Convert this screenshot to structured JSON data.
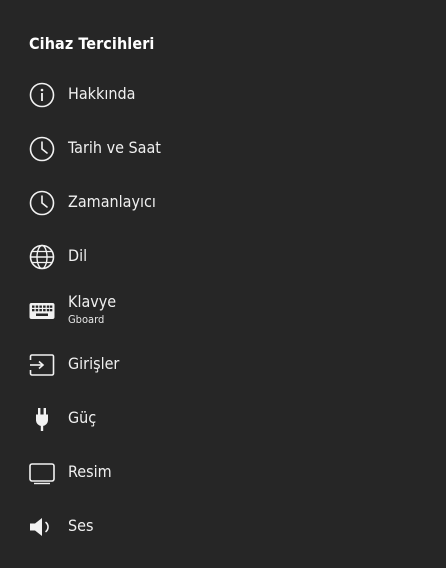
{
  "header": {
    "title": "Cihaz Tercihleri"
  },
  "items": [
    {
      "label": "Hakkında",
      "icon": "info-icon"
    },
    {
      "label": "Tarih ve Saat",
      "icon": "clock-icon"
    },
    {
      "label": "Zamanlayıcı",
      "icon": "timer-icon"
    },
    {
      "label": "Dil",
      "icon": "globe-icon"
    },
    {
      "label": "Klavye",
      "subtitle": "Gboard",
      "icon": "keyboard-icon"
    },
    {
      "label": "Girişler",
      "icon": "input-icon"
    },
    {
      "label": "Güç",
      "icon": "power-plug-icon"
    },
    {
      "label": "Resim",
      "icon": "picture-icon"
    },
    {
      "label": "Ses",
      "icon": "sound-icon"
    }
  ]
}
